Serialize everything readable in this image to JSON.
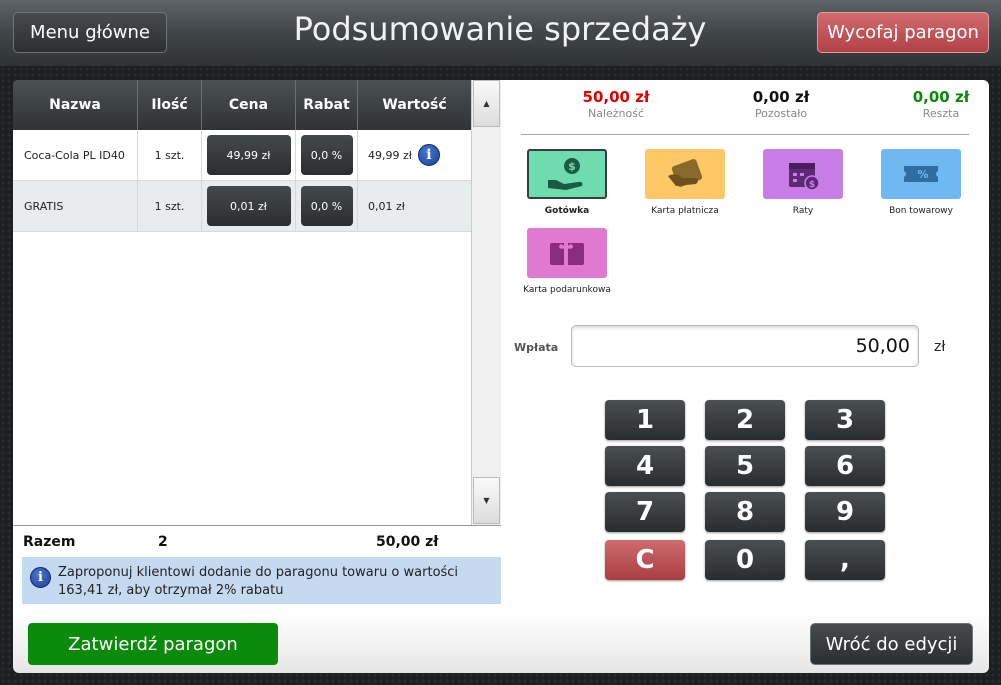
{
  "header": {
    "menu_label": "Menu główne",
    "title": "Podsumowanie sprzedaży",
    "cancel_label": "Wycofaj paragon"
  },
  "table": {
    "columns": [
      "Nazwa",
      "Ilość",
      "Cena",
      "Rabat",
      "Wartość"
    ],
    "rows": [
      {
        "name": "Coca-Cola PL ID40",
        "qty": "1 szt.",
        "price": "49,99 zł",
        "discount": "0,0 %",
        "value": "49,99 zł",
        "info_icon": "info-icon"
      },
      {
        "name": "GRATIS",
        "qty": "1 szt.",
        "price": "0,01 zł",
        "discount": "0,0 %",
        "value": "0,01 zł"
      }
    ],
    "scroll_up_icon": "triangle-up-icon",
    "scroll_down_icon": "triangle-down-icon"
  },
  "summary": {
    "label": "Razem",
    "count": "2",
    "total": "50,00 zł"
  },
  "hint": {
    "icon": "info-icon",
    "text": "Zaproponuj klientowi dodanie do paragonu towaru o wartości 163,41 zł, aby otrzymał 2% rabatu"
  },
  "amounts": {
    "due": {
      "value": "50,00 zł",
      "label": "Należność",
      "color": "#e00000"
    },
    "remaining": {
      "value": "0,00 zł",
      "label": "Pozostało",
      "color": "#111111"
    },
    "change": {
      "value": "0,00 zł",
      "label": "Reszta",
      "color": "#0a8a0a"
    }
  },
  "payment_methods": [
    {
      "label": "Gotówka",
      "icon": "cash-hand-icon",
      "color": "#6fdcb0",
      "selected": true
    },
    {
      "label": "Karta płatnicza",
      "icon": "card-hand-icon",
      "color": "#fdc865"
    },
    {
      "label": "Raty",
      "icon": "calendar-money-icon",
      "color": "#c87de6"
    },
    {
      "label": "Bon towarowy",
      "icon": "voucher-percent-icon",
      "color": "#6fb8f0"
    },
    {
      "label": "Karta podarunkowa",
      "icon": "gift-card-icon",
      "color": "#e07ad0"
    }
  ],
  "payment_input": {
    "label": "Wpłata",
    "value": "50,00",
    "unit": "zł"
  },
  "keypad": [
    "1",
    "2",
    "3",
    "4",
    "5",
    "6",
    "7",
    "8",
    "9",
    "C",
    "0",
    ","
  ],
  "footer": {
    "confirm_label": "Zatwierdź paragon",
    "back_label": "Wróć do edycji"
  }
}
